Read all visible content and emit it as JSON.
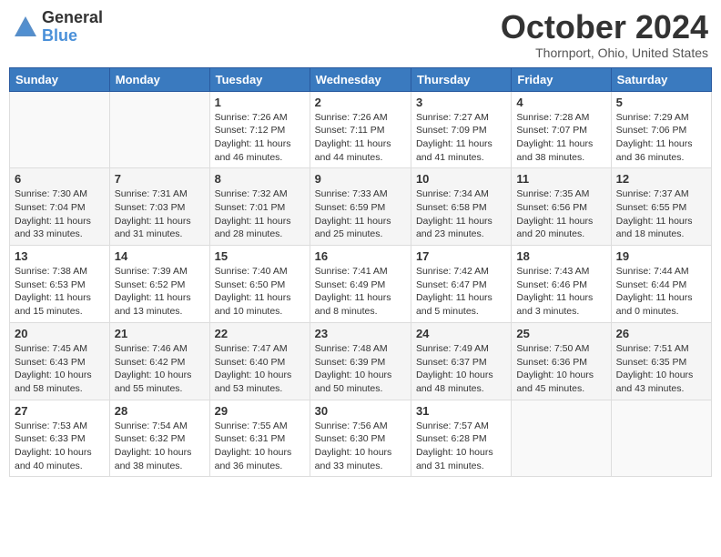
{
  "header": {
    "logo_general": "General",
    "logo_blue": "Blue",
    "month_title": "October 2024",
    "location": "Thornport, Ohio, United States"
  },
  "columns": [
    "Sunday",
    "Monday",
    "Tuesday",
    "Wednesday",
    "Thursday",
    "Friday",
    "Saturday"
  ],
  "weeks": [
    {
      "days": [
        {
          "num": "",
          "info": ""
        },
        {
          "num": "",
          "info": ""
        },
        {
          "num": "1",
          "info": "Sunrise: 7:26 AM\nSunset: 7:12 PM\nDaylight: 11 hours and 46 minutes."
        },
        {
          "num": "2",
          "info": "Sunrise: 7:26 AM\nSunset: 7:11 PM\nDaylight: 11 hours and 44 minutes."
        },
        {
          "num": "3",
          "info": "Sunrise: 7:27 AM\nSunset: 7:09 PM\nDaylight: 11 hours and 41 minutes."
        },
        {
          "num": "4",
          "info": "Sunrise: 7:28 AM\nSunset: 7:07 PM\nDaylight: 11 hours and 38 minutes."
        },
        {
          "num": "5",
          "info": "Sunrise: 7:29 AM\nSunset: 7:06 PM\nDaylight: 11 hours and 36 minutes."
        }
      ]
    },
    {
      "days": [
        {
          "num": "6",
          "info": "Sunrise: 7:30 AM\nSunset: 7:04 PM\nDaylight: 11 hours and 33 minutes."
        },
        {
          "num": "7",
          "info": "Sunrise: 7:31 AM\nSunset: 7:03 PM\nDaylight: 11 hours and 31 minutes."
        },
        {
          "num": "8",
          "info": "Sunrise: 7:32 AM\nSunset: 7:01 PM\nDaylight: 11 hours and 28 minutes."
        },
        {
          "num": "9",
          "info": "Sunrise: 7:33 AM\nSunset: 6:59 PM\nDaylight: 11 hours and 25 minutes."
        },
        {
          "num": "10",
          "info": "Sunrise: 7:34 AM\nSunset: 6:58 PM\nDaylight: 11 hours and 23 minutes."
        },
        {
          "num": "11",
          "info": "Sunrise: 7:35 AM\nSunset: 6:56 PM\nDaylight: 11 hours and 20 minutes."
        },
        {
          "num": "12",
          "info": "Sunrise: 7:37 AM\nSunset: 6:55 PM\nDaylight: 11 hours and 18 minutes."
        }
      ]
    },
    {
      "days": [
        {
          "num": "13",
          "info": "Sunrise: 7:38 AM\nSunset: 6:53 PM\nDaylight: 11 hours and 15 minutes."
        },
        {
          "num": "14",
          "info": "Sunrise: 7:39 AM\nSunset: 6:52 PM\nDaylight: 11 hours and 13 minutes."
        },
        {
          "num": "15",
          "info": "Sunrise: 7:40 AM\nSunset: 6:50 PM\nDaylight: 11 hours and 10 minutes."
        },
        {
          "num": "16",
          "info": "Sunrise: 7:41 AM\nSunset: 6:49 PM\nDaylight: 11 hours and 8 minutes."
        },
        {
          "num": "17",
          "info": "Sunrise: 7:42 AM\nSunset: 6:47 PM\nDaylight: 11 hours and 5 minutes."
        },
        {
          "num": "18",
          "info": "Sunrise: 7:43 AM\nSunset: 6:46 PM\nDaylight: 11 hours and 3 minutes."
        },
        {
          "num": "19",
          "info": "Sunrise: 7:44 AM\nSunset: 6:44 PM\nDaylight: 11 hours and 0 minutes."
        }
      ]
    },
    {
      "days": [
        {
          "num": "20",
          "info": "Sunrise: 7:45 AM\nSunset: 6:43 PM\nDaylight: 10 hours and 58 minutes."
        },
        {
          "num": "21",
          "info": "Sunrise: 7:46 AM\nSunset: 6:42 PM\nDaylight: 10 hours and 55 minutes."
        },
        {
          "num": "22",
          "info": "Sunrise: 7:47 AM\nSunset: 6:40 PM\nDaylight: 10 hours and 53 minutes."
        },
        {
          "num": "23",
          "info": "Sunrise: 7:48 AM\nSunset: 6:39 PM\nDaylight: 10 hours and 50 minutes."
        },
        {
          "num": "24",
          "info": "Sunrise: 7:49 AM\nSunset: 6:37 PM\nDaylight: 10 hours and 48 minutes."
        },
        {
          "num": "25",
          "info": "Sunrise: 7:50 AM\nSunset: 6:36 PM\nDaylight: 10 hours and 45 minutes."
        },
        {
          "num": "26",
          "info": "Sunrise: 7:51 AM\nSunset: 6:35 PM\nDaylight: 10 hours and 43 minutes."
        }
      ]
    },
    {
      "days": [
        {
          "num": "27",
          "info": "Sunrise: 7:53 AM\nSunset: 6:33 PM\nDaylight: 10 hours and 40 minutes."
        },
        {
          "num": "28",
          "info": "Sunrise: 7:54 AM\nSunset: 6:32 PM\nDaylight: 10 hours and 38 minutes."
        },
        {
          "num": "29",
          "info": "Sunrise: 7:55 AM\nSunset: 6:31 PM\nDaylight: 10 hours and 36 minutes."
        },
        {
          "num": "30",
          "info": "Sunrise: 7:56 AM\nSunset: 6:30 PM\nDaylight: 10 hours and 33 minutes."
        },
        {
          "num": "31",
          "info": "Sunrise: 7:57 AM\nSunset: 6:28 PM\nDaylight: 10 hours and 31 minutes."
        },
        {
          "num": "",
          "info": ""
        },
        {
          "num": "",
          "info": ""
        }
      ]
    }
  ]
}
